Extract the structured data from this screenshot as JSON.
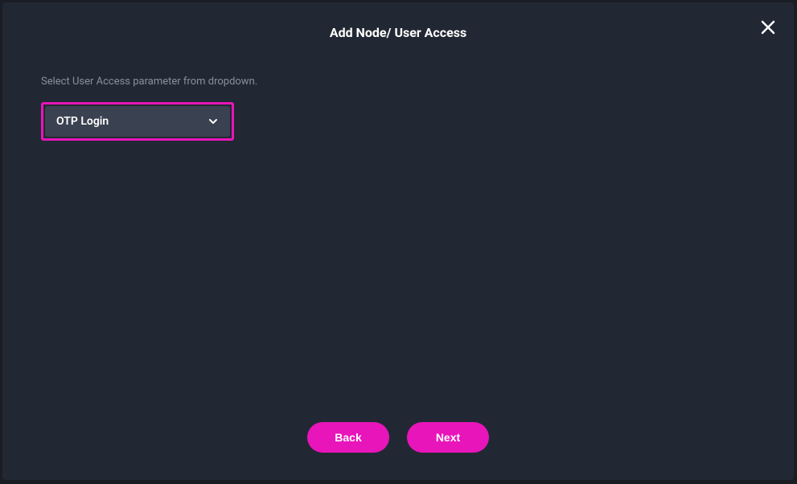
{
  "modal": {
    "title": "Add Node/ User Access",
    "instruction": "Select User Access parameter from dropdown."
  },
  "dropdown": {
    "selected": "OTP Login"
  },
  "buttons": {
    "back": "Back",
    "next": "Next"
  }
}
